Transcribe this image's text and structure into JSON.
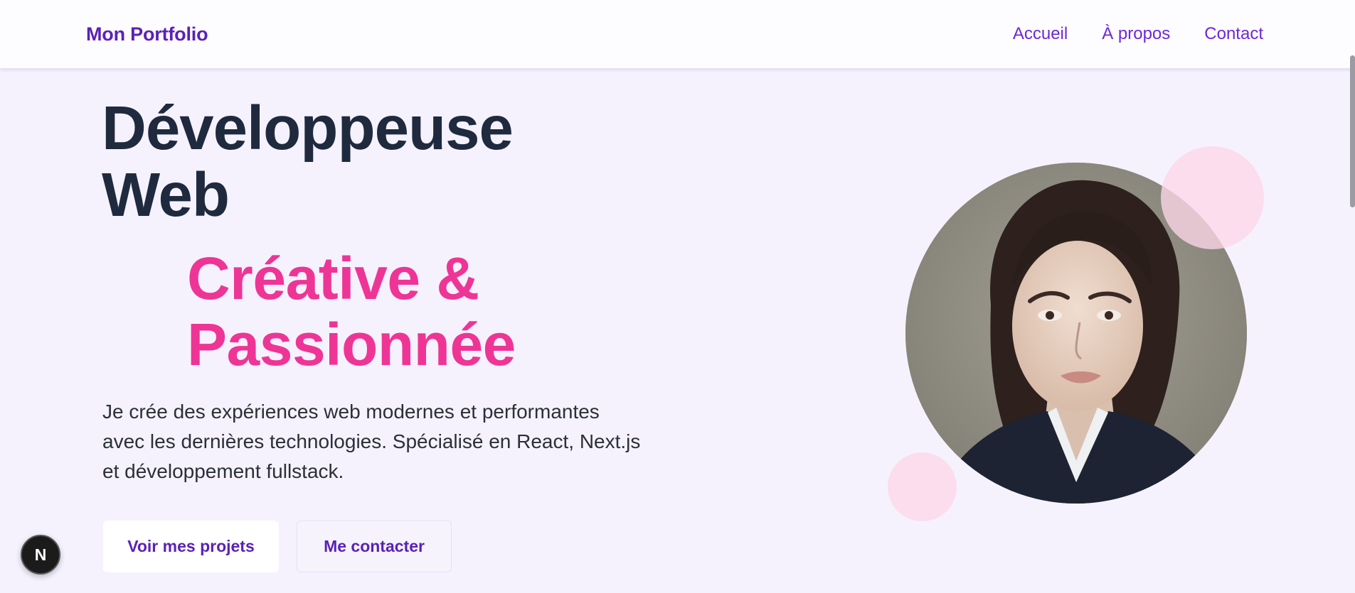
{
  "header": {
    "brand": "Mon Portfolio",
    "nav": [
      "Accueil",
      "À propos",
      "Contact"
    ]
  },
  "hero": {
    "title_line1": "Développeuse",
    "title_line2": "Web",
    "accent_line1": "Créative &",
    "accent_line2": "Passionnée",
    "description": "Je crée des expériences web modernes et performantes avec les dernières technologies. Spécialisé en React, Next.js et développement fullstack.",
    "primary_button": "Voir mes projets",
    "secondary_button": "Me contacter"
  },
  "badge": {
    "letter": "N"
  },
  "colors": {
    "background": "#f5f2fe",
    "brand_purple": "#5b21b6",
    "heading": "#1f2a3e",
    "accent_pink": "#ee3596",
    "decor_pink": "#fcd7e8"
  },
  "icons": [
    "profile-photo",
    "nextjs-logo-icon"
  ]
}
